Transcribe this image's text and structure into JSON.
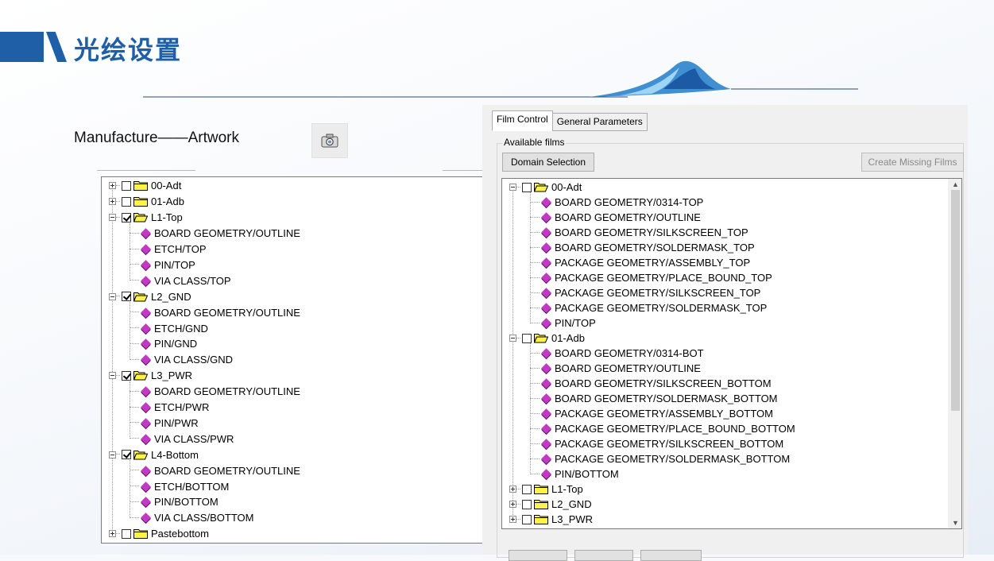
{
  "slide": {
    "title": "光绘设置",
    "caption": "Manufacture——Artwork",
    "colors": {
      "accent": "#1f5fa8",
      "leaf_icon": "#c239c4",
      "folder": "#fff34a"
    }
  },
  "left_tree": {
    "items": [
      {
        "level": 0,
        "expander": "plus",
        "checked": false,
        "open": false,
        "label": "00-Adt"
      },
      {
        "level": 0,
        "expander": "plus",
        "checked": false,
        "open": false,
        "label": "01-Adb"
      },
      {
        "level": 0,
        "expander": "minus",
        "checked": true,
        "open": true,
        "label": "L1-Top"
      },
      {
        "level": 1,
        "label": "BOARD GEOMETRY/OUTLINE"
      },
      {
        "level": 1,
        "label": "ETCH/TOP"
      },
      {
        "level": 1,
        "label": "PIN/TOP"
      },
      {
        "level": 1,
        "label": "VIA CLASS/TOP"
      },
      {
        "level": 0,
        "expander": "minus",
        "checked": true,
        "open": true,
        "label": "L2_GND"
      },
      {
        "level": 1,
        "label": "BOARD GEOMETRY/OUTLINE"
      },
      {
        "level": 1,
        "label": "ETCH/GND"
      },
      {
        "level": 1,
        "label": "PIN/GND"
      },
      {
        "level": 1,
        "label": "VIA CLASS/GND"
      },
      {
        "level": 0,
        "expander": "minus",
        "checked": true,
        "open": true,
        "label": "L3_PWR"
      },
      {
        "level": 1,
        "label": "BOARD GEOMETRY/OUTLINE"
      },
      {
        "level": 1,
        "label": "ETCH/PWR"
      },
      {
        "level": 1,
        "label": "PIN/PWR"
      },
      {
        "level": 1,
        "label": "VIA CLASS/PWR"
      },
      {
        "level": 0,
        "expander": "minus",
        "checked": true,
        "open": true,
        "label": "L4-Bottom"
      },
      {
        "level": 1,
        "label": "BOARD GEOMETRY/OUTLINE"
      },
      {
        "level": 1,
        "label": "ETCH/BOTTOM"
      },
      {
        "level": 1,
        "label": "PIN/BOTTOM"
      },
      {
        "level": 1,
        "label": "VIA CLASS/BOTTOM"
      },
      {
        "level": 0,
        "expander": "plus",
        "checked": false,
        "open": false,
        "label": "Pastebottom"
      }
    ]
  },
  "dialog": {
    "tabs": [
      "Film Control",
      "General Parameters"
    ],
    "active_tab": "Film Control",
    "group_label": "Available films",
    "domain_button": "Domain Selection",
    "create_button": "Create Missing Films",
    "tree": [
      {
        "level": 0,
        "expander": "minus",
        "checked": false,
        "open": true,
        "label": "00-Adt"
      },
      {
        "level": 1,
        "label": "BOARD GEOMETRY/0314-TOP"
      },
      {
        "level": 1,
        "label": "BOARD GEOMETRY/OUTLINE"
      },
      {
        "level": 1,
        "label": "BOARD GEOMETRY/SILKSCREEN_TOP"
      },
      {
        "level": 1,
        "label": "BOARD GEOMETRY/SOLDERMASK_TOP"
      },
      {
        "level": 1,
        "label": "PACKAGE GEOMETRY/ASSEMBLY_TOP"
      },
      {
        "level": 1,
        "label": "PACKAGE GEOMETRY/PLACE_BOUND_TOP"
      },
      {
        "level": 1,
        "label": "PACKAGE GEOMETRY/SILKSCREEN_TOP"
      },
      {
        "level": 1,
        "label": "PACKAGE GEOMETRY/SOLDERMASK_TOP"
      },
      {
        "level": 1,
        "label": "PIN/TOP"
      },
      {
        "level": 0,
        "expander": "minus",
        "checked": false,
        "open": true,
        "label": "01-Adb"
      },
      {
        "level": 1,
        "label": "BOARD GEOMETRY/0314-BOT"
      },
      {
        "level": 1,
        "label": "BOARD GEOMETRY/OUTLINE"
      },
      {
        "level": 1,
        "label": "BOARD GEOMETRY/SILKSCREEN_BOTTOM"
      },
      {
        "level": 1,
        "label": "BOARD GEOMETRY/SOLDERMASK_BOTTOM"
      },
      {
        "level": 1,
        "label": "PACKAGE GEOMETRY/ASSEMBLY_BOTTOM"
      },
      {
        "level": 1,
        "label": "PACKAGE GEOMETRY/PLACE_BOUND_BOTTOM"
      },
      {
        "level": 1,
        "label": "PACKAGE GEOMETRY/SILKSCREEN_BOTTOM"
      },
      {
        "level": 1,
        "label": "PACKAGE GEOMETRY/SOLDERMASK_BOTTOM"
      },
      {
        "level": 1,
        "label": "PIN/BOTTOM"
      },
      {
        "level": 0,
        "expander": "plus",
        "checked": false,
        "open": false,
        "label": "L1-Top"
      },
      {
        "level": 0,
        "expander": "plus",
        "checked": false,
        "open": false,
        "label": "L2_GND"
      },
      {
        "level": 0,
        "expander": "plus",
        "checked": false,
        "open": false,
        "label": "L3_PWR"
      }
    ]
  }
}
